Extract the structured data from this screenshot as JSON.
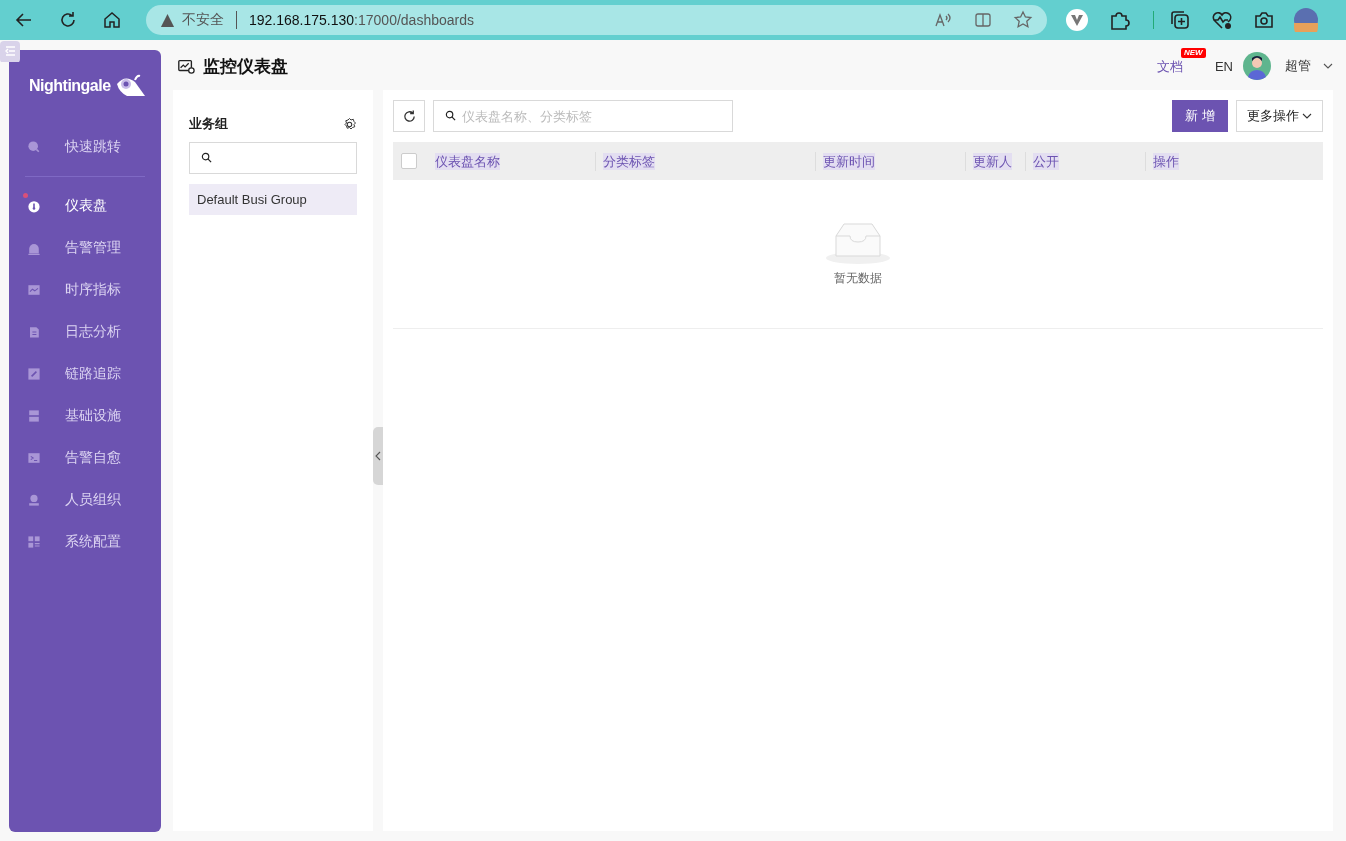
{
  "browser": {
    "security": "不安全",
    "url_host": "192.168.175.130",
    "url_rest": ":17000/dashboards"
  },
  "sidebar": {
    "logo": "Nightingale",
    "items": [
      {
        "label": "快速跳转",
        "selected": false,
        "dot": false
      },
      {
        "label": "仪表盘",
        "selected": true,
        "dot": true
      },
      {
        "label": "告警管理",
        "selected": false,
        "dot": false
      },
      {
        "label": "时序指标",
        "selected": false,
        "dot": false
      },
      {
        "label": "日志分析",
        "selected": false,
        "dot": false
      },
      {
        "label": "链路追踪",
        "selected": false,
        "dot": false
      },
      {
        "label": "基础设施",
        "selected": false,
        "dot": false
      },
      {
        "label": "告警自愈",
        "selected": false,
        "dot": false
      },
      {
        "label": "人员组织",
        "selected": false,
        "dot": false
      },
      {
        "label": "系统配置",
        "selected": false,
        "dot": false
      }
    ]
  },
  "header": {
    "title": "监控仪表盘",
    "docs_link": "文档",
    "new_badge": "NEW",
    "language": "EN",
    "user": "超管"
  },
  "group_panel": {
    "title": "业务组",
    "groups": [
      {
        "name": "Default Busi Group",
        "selected": true
      }
    ]
  },
  "toolbar": {
    "search_placeholder": "仪表盘名称、分类标签",
    "add_button": "新 增",
    "more_button": "更多操作"
  },
  "table": {
    "select_all": false,
    "columns": [
      "仪表盘名称",
      "分类标签",
      "更新时间",
      "更新人",
      "公开",
      "操作"
    ],
    "empty_text": "暂无数据"
  }
}
